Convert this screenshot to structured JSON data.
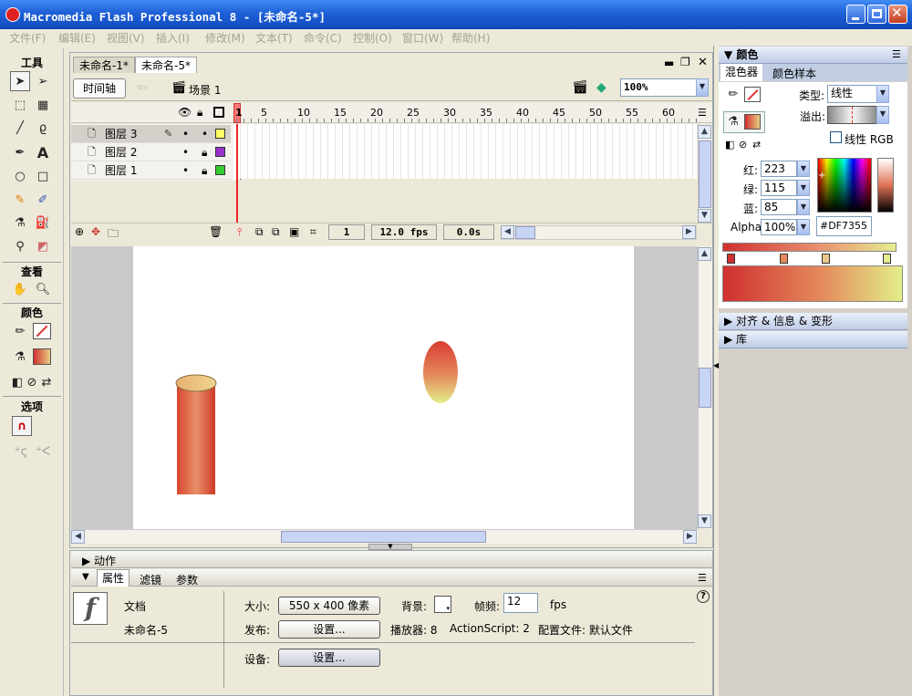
{
  "app": {
    "title": "Macromedia Flash Professional 8 - [未命名-5*]"
  },
  "menu": [
    "文件(F)",
    "编辑(E)",
    "视图(V)",
    "插入(I)",
    "修改(M)",
    "文本(T)",
    "命令(C)",
    "控制(O)",
    "窗口(W)",
    "帮助(H)"
  ],
  "tools": {
    "header": "工具",
    "view_header": "查看",
    "color_header": "颜色",
    "options_header": "选项"
  },
  "document": {
    "tabs": [
      "未命名-1*",
      "未命名-5*"
    ],
    "timeline_label": "时间轴",
    "scene_label": "场景 1",
    "zoom": "100%",
    "ruler": [
      "1",
      "5",
      "10",
      "15",
      "20",
      "25",
      "30",
      "35",
      "40",
      "45",
      "50",
      "55",
      "60"
    ],
    "layers": [
      {
        "name": "图层 3",
        "color": "#FFFF66",
        "selected": true
      },
      {
        "name": "图层 2",
        "color": "#9933CC",
        "selected": false
      },
      {
        "name": "图层 1",
        "color": "#33CC33",
        "selected": false
      }
    ],
    "status": {
      "frame": "1",
      "fps": "12.0 fps",
      "time": "0.0s"
    }
  },
  "panels": {
    "actions_label": "动作",
    "props_tabs": [
      "属性",
      "滤镜",
      "参数"
    ],
    "doc_label": "文档",
    "doc_name": "未命名-5",
    "size_label": "大小:",
    "size_value": "550 x 400 像素",
    "bg_label": "背景:",
    "fps_label": "帧频:",
    "fps_value": "12",
    "fps_unit": "fps",
    "publish_label": "发布:",
    "settings_btn": "设置...",
    "player_text": "播放器: 8",
    "actionscript_text": "ActionScript:  2",
    "profile_text": "配置文件:  默认文件",
    "device_label": "设备:",
    "device_btn": "设置...",
    "help_icon": "?"
  },
  "color_panel": {
    "title": "颜色",
    "tabs": [
      "混色器",
      "颜色样本"
    ],
    "type_label": "类型:",
    "type_value": "线性",
    "overflow_label": "溢出:",
    "linear_rgb": "线性 RGB",
    "red_label": "红:",
    "red": "223",
    "green_label": "绿:",
    "green": "115",
    "blue_label": "蓝:",
    "blue": "85",
    "alpha_label": "Alpha:",
    "alpha": "100%",
    "hex": "#DF7355",
    "align_panel": "对齐 & 信息 & 变形",
    "library_panel": "库"
  }
}
